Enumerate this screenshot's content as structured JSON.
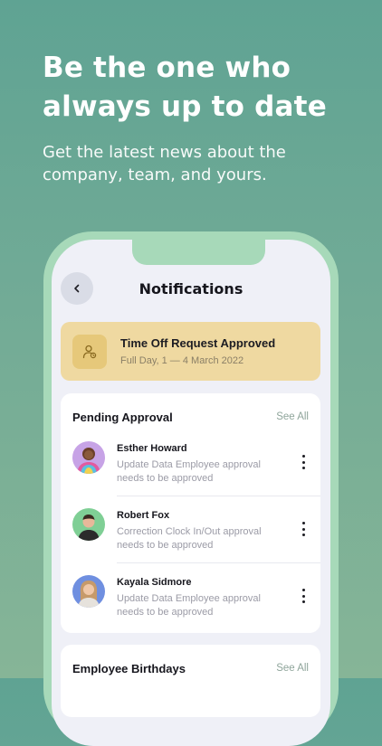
{
  "hero": {
    "headline": "Be the one who always up to date",
    "subline": "Get the latest news about the company, team, and yours."
  },
  "screen": {
    "title": "Notifications",
    "back_icon": "chevron-left-icon"
  },
  "banner": {
    "icon": "user-clock-icon",
    "title": "Time Off Request Approved",
    "subtitle": "Full Day, 1 — 4 March 2022"
  },
  "pending": {
    "title": "Pending Approval",
    "see_all": "See All",
    "items": [
      {
        "name": "Esther Howard",
        "desc": "Update Data Employee approval needs to be approved"
      },
      {
        "name": "Robert Fox",
        "desc": "Correction Clock In/Out approval needs to be approved"
      },
      {
        "name": "Kayala Sidmore",
        "desc": "Update Data Employee approval needs to be approved"
      }
    ]
  },
  "birthdays": {
    "title": "Employee Birthdays",
    "see_all": "See All"
  },
  "colors": {
    "background": "#5fa393",
    "phone_frame": "#a7d9b9",
    "banner": "#efd9a1",
    "see_all": "#8fa59b"
  }
}
